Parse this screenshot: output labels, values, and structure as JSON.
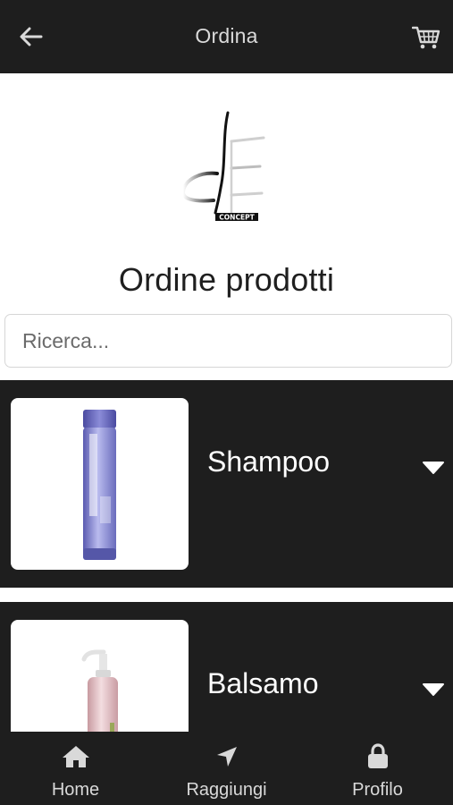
{
  "header": {
    "title": "Ordina",
    "back_icon": "arrow-left-icon",
    "cart_icon": "shopping-cart-icon"
  },
  "logo": {
    "text": "CONCEPT"
  },
  "page": {
    "title": "Ordine prodotti"
  },
  "search": {
    "placeholder": "Ricerca..."
  },
  "products": [
    {
      "name": "Shampoo",
      "icon": "caret-down-icon"
    },
    {
      "name": "Balsamo",
      "icon": "caret-down-icon"
    }
  ],
  "bottom_nav": [
    {
      "label": "Home",
      "icon": "home-icon"
    },
    {
      "label": "Raggiungi",
      "icon": "location-arrow-icon"
    },
    {
      "label": "Profilo",
      "icon": "lock-icon"
    }
  ],
  "colors": {
    "bar_background": "#1e1e1e",
    "page_background": "#ffffff",
    "text_light": "#d9d9d9"
  }
}
